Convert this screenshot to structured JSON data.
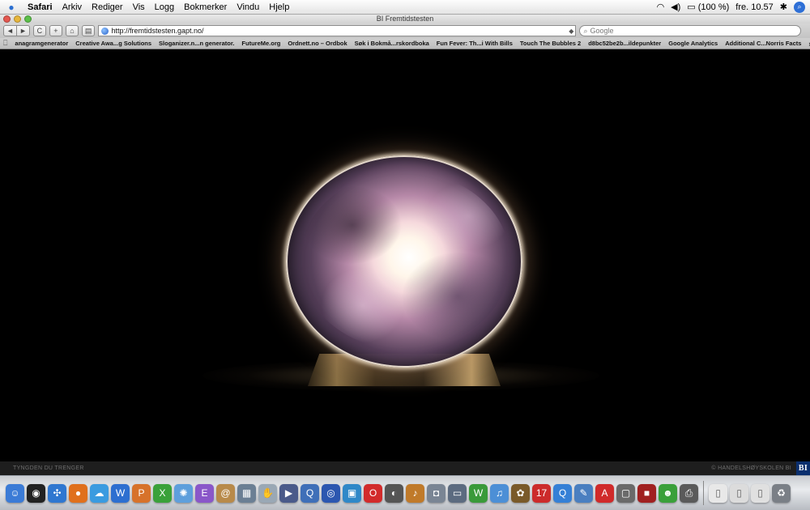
{
  "menubar": {
    "app_name": "Safari",
    "items": [
      "Arkiv",
      "Rediger",
      "Vis",
      "Logg",
      "Bokmerker",
      "Vindu",
      "Hjelp"
    ],
    "battery": "(100 %)",
    "clock": "fre. 10.57"
  },
  "window": {
    "title": "BI Fremtidstesten"
  },
  "toolbar": {
    "back": "◄",
    "forward": "►",
    "reload": "C",
    "add": "+",
    "home": "⌂",
    "print": "▤",
    "url": "http://fremtidstesten.gapt.no/",
    "search_placeholder": "Google"
  },
  "bookmarks": [
    "anagramgenerator",
    "Creative Awa...g Solutions",
    "Sloganizer.n...n generator.",
    "FutureMe.org",
    "Ordnett.no – Ordbok",
    "Søk i Bokmå...rskordboka",
    "Fun Fever: Th...i With Bills",
    "Touch The Bubbles 2",
    "d8bc52be2b...ildepunkter",
    "Google Analytics",
    "Additional C...Norris Facts"
  ],
  "footer": {
    "left": "TYNGDEN DU TRENGER",
    "right": "© HANDELSHØYSKOLEN BI",
    "logo": "BI"
  },
  "dock": [
    {
      "name": "finder-icon",
      "glyph": "☺",
      "color": "#3b7bd6"
    },
    {
      "name": "dashboard-icon",
      "glyph": "◉",
      "color": "#222222"
    },
    {
      "name": "safari-icon",
      "glyph": "✣",
      "color": "#2f77d0"
    },
    {
      "name": "firefox-icon",
      "glyph": "●",
      "color": "#e0701c"
    },
    {
      "name": "ichat-icon",
      "glyph": "☁",
      "color": "#3a9be0"
    },
    {
      "name": "word-icon",
      "glyph": "W",
      "color": "#2d6fd0"
    },
    {
      "name": "powerpoint-icon",
      "glyph": "P",
      "color": "#d7722a"
    },
    {
      "name": "excel-icon",
      "glyph": "X",
      "color": "#3aa13a"
    },
    {
      "name": "network-icon",
      "glyph": "✺",
      "color": "#5e9fdc"
    },
    {
      "name": "entourage-icon",
      "glyph": "E",
      "color": "#8a57c9"
    },
    {
      "name": "address-book-icon",
      "glyph": "@",
      "color": "#b88a4a"
    },
    {
      "name": "iphoto-icon",
      "glyph": "▦",
      "color": "#6b7f94"
    },
    {
      "name": "photo-booth-icon",
      "glyph": "✋",
      "color": "#9aa8b5"
    },
    {
      "name": "imovie-icon",
      "glyph": "▶",
      "color": "#4a5a8a"
    },
    {
      "name": "quicktime-icon",
      "glyph": "Q",
      "color": "#3f6fb8"
    },
    {
      "name": "itunes-icon",
      "glyph": "◎",
      "color": "#2c57b0"
    },
    {
      "name": "dvd-player-icon",
      "glyph": "▣",
      "color": "#2f88c8"
    },
    {
      "name": "opera-icon",
      "glyph": "O",
      "color": "#d22b2b"
    },
    {
      "name": "time-machine-icon",
      "glyph": "◐",
      "color": "#555555"
    },
    {
      "name": "garageband-icon",
      "glyph": "♪",
      "color": "#c07a2a"
    },
    {
      "name": "image-capture-icon",
      "glyph": "◘",
      "color": "#7a8594"
    },
    {
      "name": "keynote-icon",
      "glyph": "▭",
      "color": "#5c6b80"
    },
    {
      "name": "wmv-icon",
      "glyph": "W",
      "color": "#3a9a3a"
    },
    {
      "name": "itunes-note-icon",
      "glyph": "♫",
      "color": "#4c8fd6"
    },
    {
      "name": "automator-icon",
      "glyph": "✿",
      "color": "#7a5a2a"
    },
    {
      "name": "ical-icon",
      "glyph": "17",
      "color": "#cc2b2b"
    },
    {
      "name": "quicktime-q-icon",
      "glyph": "Q",
      "color": "#3580d6"
    },
    {
      "name": "mail-icon",
      "glyph": "✎",
      "color": "#4a7fc0"
    },
    {
      "name": "acrobat-icon",
      "glyph": "A",
      "color": "#d02a2a"
    },
    {
      "name": "preview-icon",
      "glyph": "▢",
      "color": "#6a6a6a"
    },
    {
      "name": "photo-app-icon",
      "glyph": "■",
      "color": "#a02020"
    },
    {
      "name": "messenger-icon",
      "glyph": "☻",
      "color": "#3aa03a"
    },
    {
      "name": "printer-icon",
      "glyph": "⎙",
      "color": "#5a5a5a"
    },
    {
      "name": "document-icon",
      "glyph": "▯",
      "color": "#e8e8e8"
    },
    {
      "name": "document-2-icon",
      "glyph": "▯",
      "color": "#dcdcdc"
    },
    {
      "name": "document-3-icon",
      "glyph": "▯",
      "color": "#e0e0e0"
    },
    {
      "name": "trash-icon",
      "glyph": "♻",
      "color": "#7a7f86"
    }
  ]
}
